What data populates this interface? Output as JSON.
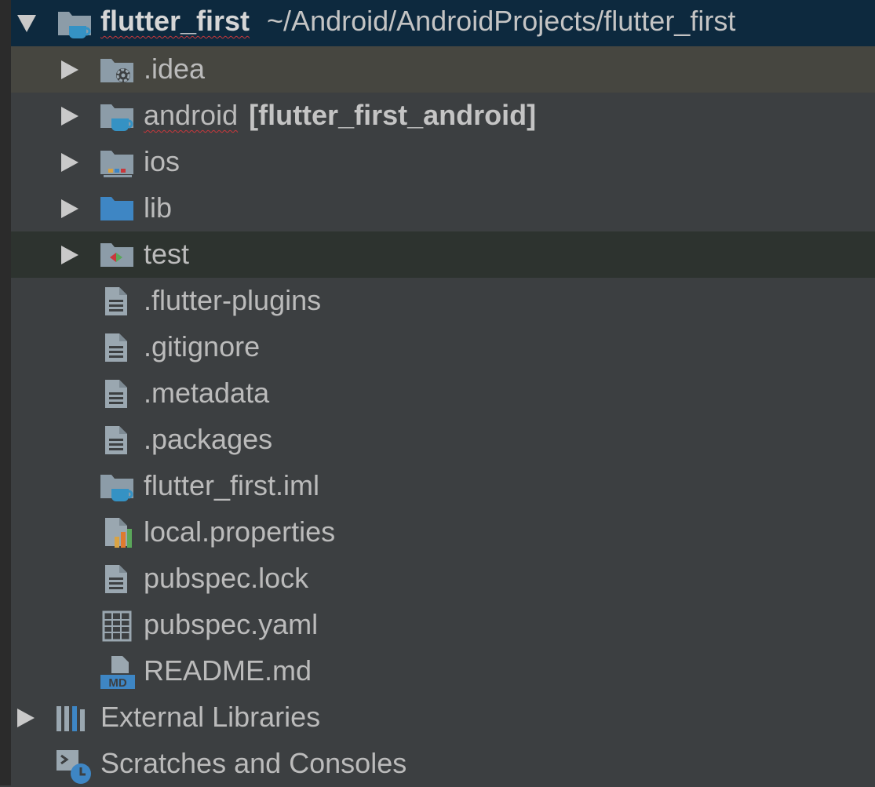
{
  "project_tree": {
    "root": {
      "name": "flutter_first",
      "path": "~/Android/AndroidProjects/flutter_first"
    },
    "items": [
      {
        "label": ".idea"
      },
      {
        "label": "android",
        "module": "[flutter_first_android]"
      },
      {
        "label": "ios"
      },
      {
        "label": "lib"
      },
      {
        "label": "test"
      },
      {
        "label": ".flutter-plugins"
      },
      {
        "label": ".gitignore"
      },
      {
        "label": ".metadata"
      },
      {
        "label": ".packages"
      },
      {
        "label": "flutter_first.iml"
      },
      {
        "label": "local.properties"
      },
      {
        "label": "pubspec.lock"
      },
      {
        "label": "pubspec.yaml"
      },
      {
        "label": "README.md",
        "icon_text": "MD"
      }
    ],
    "external_libraries": {
      "label": "External Libraries"
    },
    "scratches": {
      "label": "Scratches and Consoles"
    }
  },
  "icons": {
    "root": "flutter-module-folder-icon",
    "idea": "idea-config-folder-icon",
    "android": "android-module-folder-icon",
    "ios": "ios-folder-icon",
    "lib": "source-folder-icon",
    "test": "test-folder-icon",
    "text_file": "text-file-icon",
    "iml": "module-file-icon",
    "properties": "properties-file-icon",
    "yaml": "yaml-file-icon",
    "markdown": "markdown-file-icon",
    "libraries": "libraries-icon",
    "scratches": "scratches-icon"
  },
  "colors": {
    "background": "#3c3f41",
    "root_row": "#0d293e",
    "hover_row": "#464640",
    "test_row": "#2d332f",
    "text": "#bbbbbb",
    "folder": "#8c9ca8",
    "source_folder": "#3e86c4",
    "module_cup": "#3592c4",
    "error_underline": "#c9373b"
  }
}
